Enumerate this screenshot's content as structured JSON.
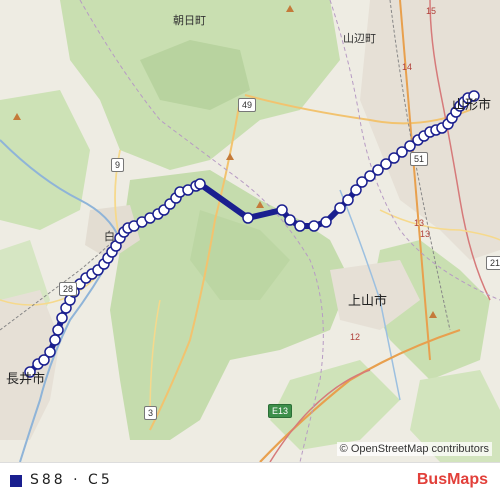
{
  "map": {
    "places": {
      "asahi": "朝日町",
      "yamabe": "山辺町",
      "yamagata": "山形市",
      "kaminoyama": "上山市",
      "nagai": "長井市",
      "shiro": "白"
    },
    "road_labels": {
      "r49": "49",
      "r9": "9",
      "r51": "51",
      "r13a": "13",
      "r13b": "13",
      "r21": "21",
      "r12": "12",
      "r3": "3",
      "r28": "28",
      "r14": "14",
      "r15": "15",
      "e13": "E13"
    },
    "attribution": "© OpenStreetMap contributors"
  },
  "route": {
    "color": "#1a1f8f",
    "stop_count": 60
  },
  "legend": {
    "label": "S88 · C5",
    "swatch_color": "#1a1f8f"
  },
  "brand": {
    "part1": "Bus",
    "part2": "Maps"
  }
}
